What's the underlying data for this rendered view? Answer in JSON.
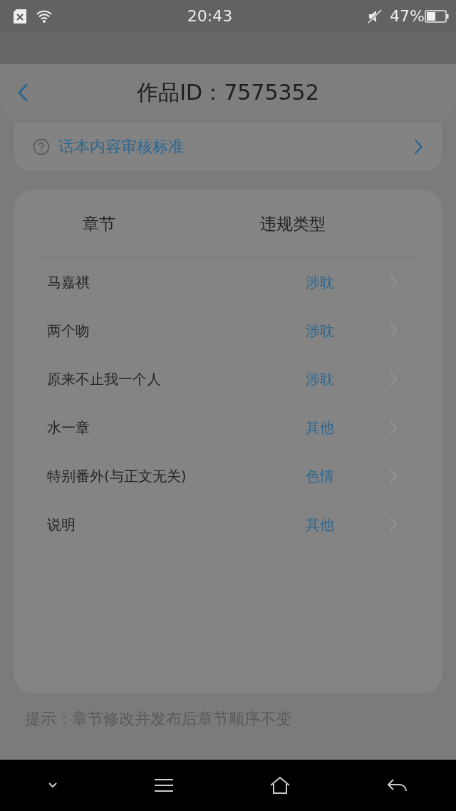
{
  "status_bar": {
    "time": "20:43",
    "battery": "47%"
  },
  "header": {
    "title": "作品ID：7575352"
  },
  "guideline_link": {
    "label": "话本内容审核标准"
  },
  "table": {
    "columns": [
      "章节",
      "违规类型"
    ],
    "rows": [
      {
        "chapter": "马嘉祺",
        "violation": "涉耽"
      },
      {
        "chapter": "两个吻",
        "violation": "涉耽"
      },
      {
        "chapter": "原来不止我一个人",
        "violation": "涉耽"
      },
      {
        "chapter": "水一章",
        "violation": "其他"
      },
      {
        "chapter": "特别番外(与正文无关)",
        "violation": "色情"
      },
      {
        "chapter": "说明",
        "violation": "其他"
      }
    ]
  },
  "hint": "提示：章节修改并发布后章节顺序不变"
}
